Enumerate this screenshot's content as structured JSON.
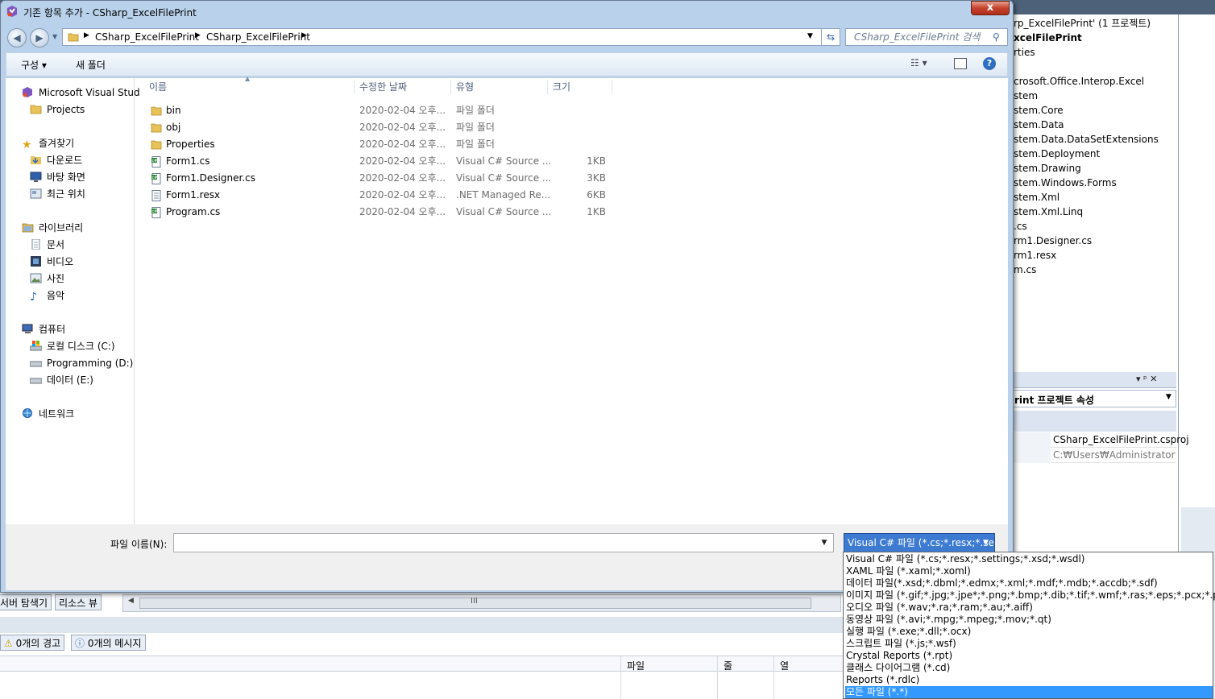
{
  "dialog": {
    "title": "기존 항목 추가 - CSharp_ExcelFilePrint",
    "close_label": "x",
    "breadcrumb": [
      "CSharp_ExcelFilePrint",
      "CSharp_ExcelFilePrint"
    ],
    "search_placeholder": "CSharp_ExcelFilePrint 검색",
    "toolbar": {
      "organize": "구성 ▾",
      "new_folder": "새 폴더"
    },
    "nav": {
      "top": "Microsoft Visual Stud",
      "projects": "Projects",
      "favorites": "즐겨찾기",
      "downloads": "다운로드",
      "desktop": "바탕 화면",
      "recent": "최근 위치",
      "libraries": "라이브러리",
      "documents": "문서",
      "videos": "비디오",
      "pictures": "사진",
      "music": "음악",
      "computer": "컴퓨터",
      "drive_c": "로컬 디스크 (C:)",
      "drive_d": "Programming (D:)",
      "drive_e": "데이터 (E:)",
      "network": "네트워크"
    },
    "columns": {
      "name": "이름",
      "modified": "수정한 날짜",
      "type": "유형",
      "size": "크기"
    },
    "files": [
      {
        "name": "bin",
        "modified": "2020-02-04 오후...",
        "type": "파일 폴더",
        "size": "",
        "icon": "folder-icon"
      },
      {
        "name": "obj",
        "modified": "2020-02-04 오후...",
        "type": "파일 폴더",
        "size": "",
        "icon": "folder-icon"
      },
      {
        "name": "Properties",
        "modified": "2020-02-04 오후...",
        "type": "파일 폴더",
        "size": "",
        "icon": "folder-icon"
      },
      {
        "name": "Form1.cs",
        "modified": "2020-02-04 오후...",
        "type": "Visual C# Source ...",
        "size": "1KB",
        "icon": "csharp-file-icon"
      },
      {
        "name": "Form1.Designer.cs",
        "modified": "2020-02-04 오후...",
        "type": "Visual C# Source ...",
        "size": "3KB",
        "icon": "csharp-file-icon"
      },
      {
        "name": "Form1.resx",
        "modified": "2020-02-04 오후...",
        "type": ".NET Managed Re...",
        "size": "6KB",
        "icon": "resx-file-icon"
      },
      {
        "name": "Program.cs",
        "modified": "2020-02-04 오후...",
        "type": "Visual C# Source ...",
        "size": "1KB",
        "icon": "csharp-file-icon"
      }
    ],
    "filename_label": "파일 이름(N):",
    "filename_value": "",
    "filter_selected": "Visual C# 파일 (*.cs;*.resx;*.set",
    "filter_options": [
      "Visual C# 파일 (*.cs;*.resx;*.settings;*.xsd;*.wsdl)",
      "XAML 파일 (*.xaml;*.xoml)",
      "데이터 파일(*.xsd;*.dbml;*.edmx;*.xml;*.mdf;*.mdb;*.accdb;*.sdf)",
      "이미지 파일 (*.gif;*.jpg;*.jpe*;*.png;*.bmp;*.dib;*.tif;*.wmf;*.ras;*.eps;*.pcx;*.pcd;*.tga)",
      "오디오 파일 (*.wav;*.ra;*.ram;*.au;*.aiff)",
      "동영상 파일 (*.avi;*.mpg;*.mpeg;*.mov;*.qt)",
      "실행 파일 (*.exe;*.dll;*.ocx)",
      "스크립트 파일 (*.js;*.wsf)",
      "Crystal Reports (*.rpt)",
      "클래스 다이어그램 (*.cd)",
      "Reports (*.rdlc)",
      "모든 파일 (*.*)"
    ],
    "filter_highlight_index": 11
  },
  "ide": {
    "solution_items": [
      "rp_ExcelFilePrint' (1 프로젝트)",
      "xcelFilePrint",
      "rties",
      "",
      "crosoft.Office.Interop.Excel",
      "stem",
      "stem.Core",
      "stem.Data",
      "stem.Data.DataSetExtensions",
      "stem.Deployment",
      "stem.Drawing",
      "stem.Windows.Forms",
      "stem.Xml",
      "stem.Xml.Linq",
      ".cs",
      "rm1.Designer.cs",
      "rm1.resx",
      "m.cs"
    ],
    "properties_header_buttons": "▾ ᵖ ✕",
    "properties_combo": "rint 프로젝트 속성",
    "prop_file": "CSharp_ExcelFilePrint.csproj",
    "prop_path": "C:₩Users₩Administrator₩De",
    "tab_server": "서버 탐색기",
    "tab_resource": "리소스 뷰",
    "warnings": "0개의 경고",
    "messages": "0개의 메시지",
    "err_cols": {
      "file": "파일",
      "line": "줄",
      "col": "열"
    },
    "scroll_grip": "III"
  }
}
